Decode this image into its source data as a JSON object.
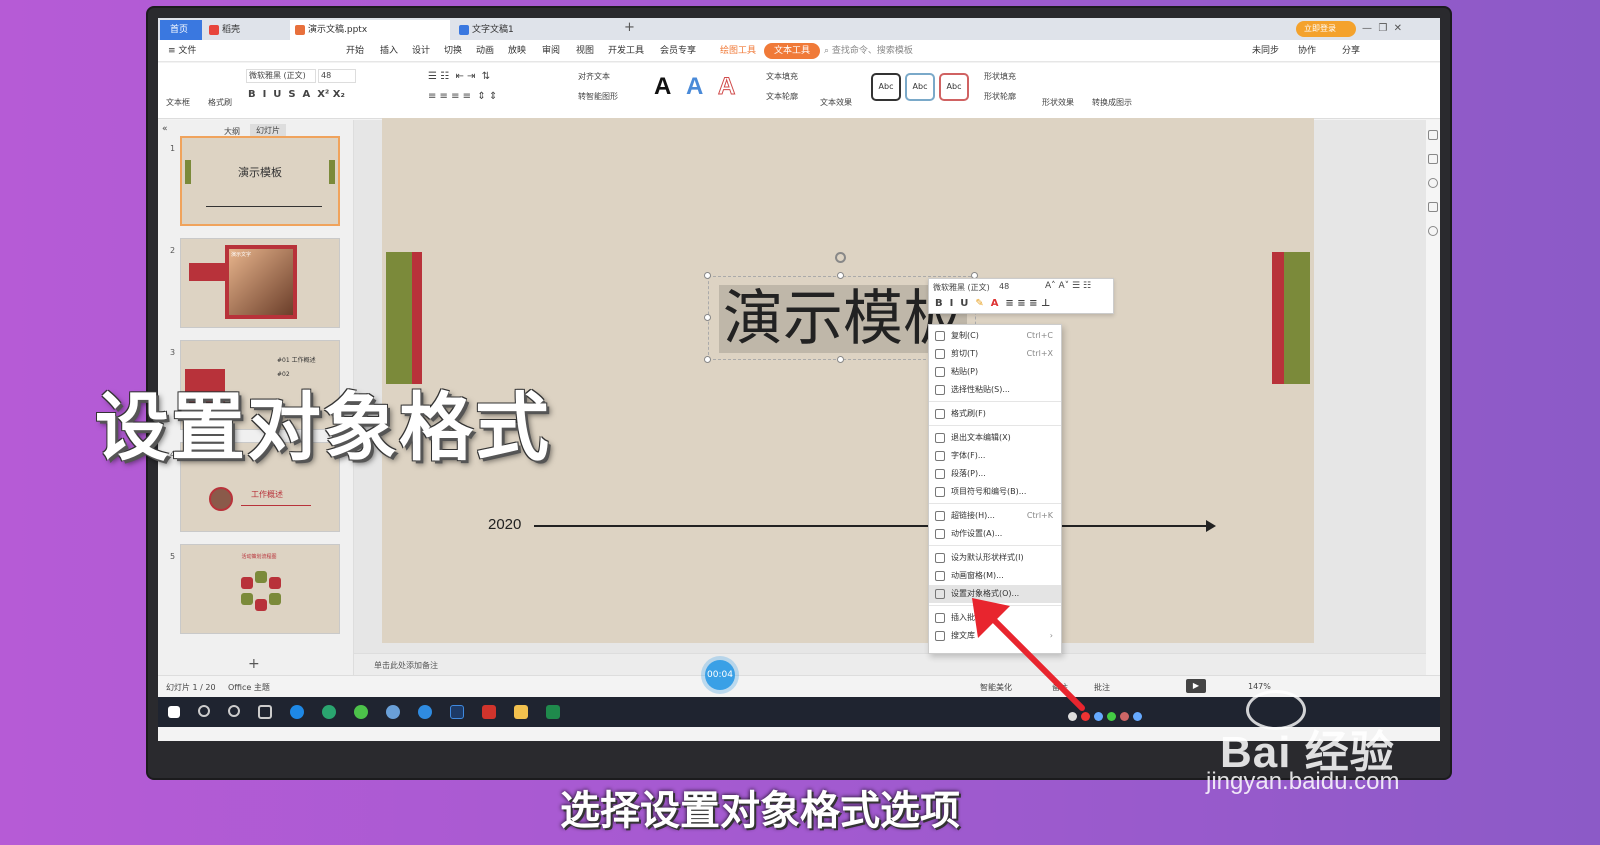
{
  "tabs": {
    "home": "首页",
    "shell": "稻壳",
    "doc": "演示文稿.pptx",
    "doc2": "文字文稿1",
    "add": "+"
  },
  "login": "立即登录",
  "menu": {
    "file": "≡ 文件",
    "start": "开始",
    "insert": "插入",
    "design": "设计",
    "switch": "切换",
    "animation": "动画",
    "show": "放映",
    "review": "审阅",
    "view": "视图",
    "dev": "开发工具",
    "member": "会员专享",
    "draw_tool": "绘图工具",
    "text_tool": "文本工具",
    "search": "查找命令、搜索模板",
    "sync": "未同步",
    "collab": "协作",
    "share": "分享"
  },
  "ribbon": {
    "textbox": "文本框",
    "format_brush": "格式刷",
    "font_name": "微软雅黑 (正文)",
    "font_size": "48",
    "align_text": "对齐文本",
    "smart_art": "转智能图形",
    "text_fill": "文本填充",
    "text_outline": "文本轮廓",
    "text_effect": "文本效果",
    "shape_fill": "形状填充",
    "shape_outline": "形状轮廓",
    "shape_effect": "形状效果",
    "convert": "转换成图示",
    "abc": "Abc",
    "bigA": "A"
  },
  "panel": {
    "outline_tab": "大纲",
    "slides_tab": "幻灯片",
    "add": "+"
  },
  "thumbs": [
    {
      "num": "1",
      "title": "演示模板"
    },
    {
      "num": "2",
      "title": "演示文字"
    },
    {
      "num": "3",
      "label1": "#01  工作概述",
      "label2": "#02"
    },
    {
      "num": "4",
      "title": "工作概述"
    },
    {
      "num": "5",
      "title": "活动策划流程图"
    }
  ],
  "slide": {
    "title": "演示模板",
    "year": "2020"
  },
  "minitoolbar": {
    "font": "微软雅黑 (正文)",
    "size": "48"
  },
  "context_menu": [
    {
      "label": "复制(C)",
      "shortcut": "Ctrl+C"
    },
    {
      "label": "剪切(T)",
      "shortcut": "Ctrl+X"
    },
    {
      "label": "粘贴(P)",
      "shortcut": ""
    },
    {
      "label": "选择性粘贴(S)...",
      "shortcut": ""
    },
    {
      "label": "格式刷(F)",
      "shortcut": ""
    },
    {
      "label": "退出文本编辑(X)",
      "shortcut": ""
    },
    {
      "label": "字体(F)...",
      "shortcut": ""
    },
    {
      "label": "段落(P)...",
      "shortcut": ""
    },
    {
      "label": "项目符号和编号(B)...",
      "shortcut": ""
    },
    {
      "label": "超链接(H)...",
      "shortcut": "Ctrl+K"
    },
    {
      "label": "动作设置(A)...",
      "shortcut": ""
    },
    {
      "label": "设为默认形状样式(I)",
      "shortcut": ""
    },
    {
      "label": "动画窗格(M)...",
      "shortcut": ""
    },
    {
      "label": "设置对象格式(O)...",
      "shortcut": ""
    },
    {
      "label": "插入批注(M)",
      "shortcut": ""
    },
    {
      "label": "搜文库",
      "shortcut": "›"
    }
  ],
  "notes": "单击此处添加备注",
  "status": {
    "slide": "幻灯片 1 / 20",
    "theme": "Office 主题",
    "beautify": "智能美化",
    "notes_btn": "备注",
    "comment": "批注",
    "zoom": "147%"
  },
  "timer": "00:04",
  "overlay": {
    "title": "设置对象格式",
    "subtitle": "选择设置对象格式选项"
  },
  "watermark": {
    "brand": "Bai 经验",
    "url": "jingyan.baidu.com"
  },
  "colors": {
    "accent": "#f07a38",
    "slide_bg": "#ddd3c3",
    "green_bar": "#7b8a3a",
    "red_bar": "#b8323a"
  }
}
